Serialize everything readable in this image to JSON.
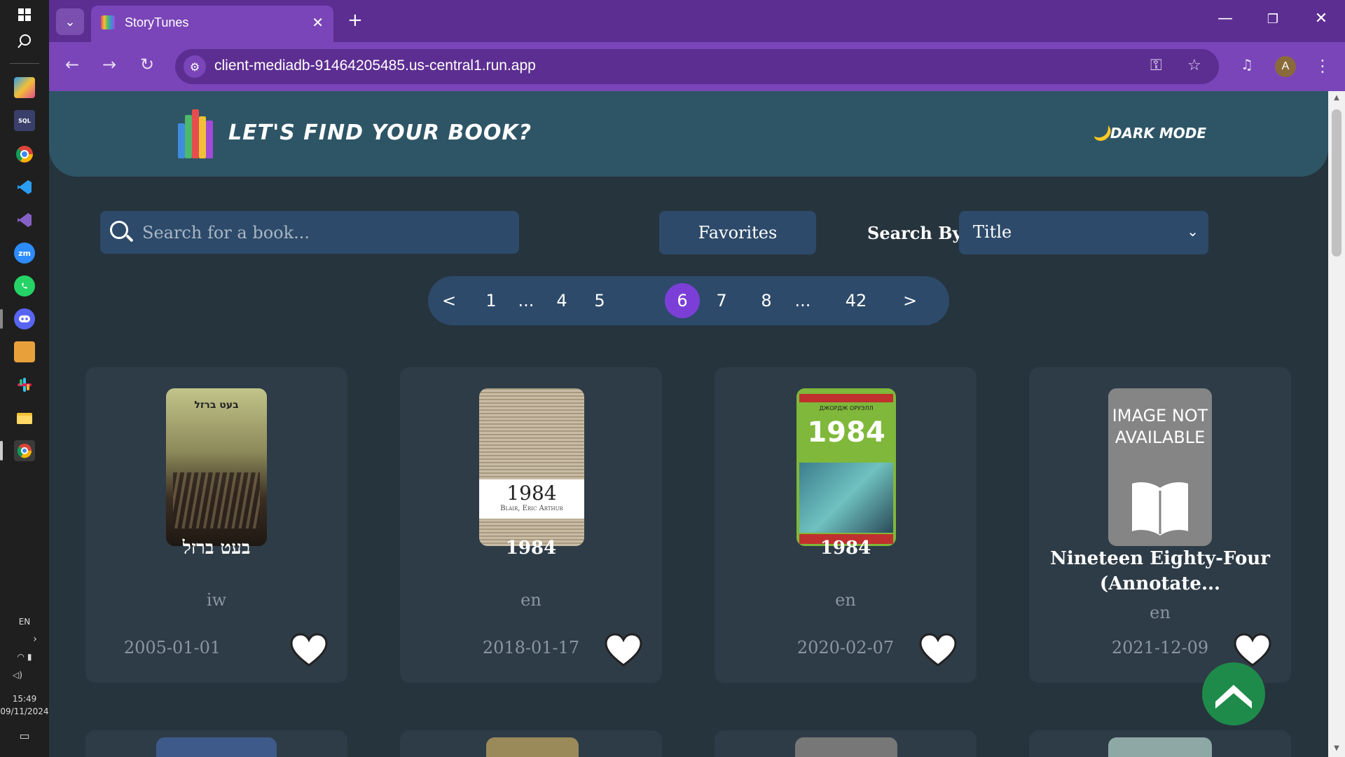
{
  "browser": {
    "tab_title": "StoryTunes",
    "url": "client-mediadb-91464205485.us-central1.run.app",
    "profile_initial": "A"
  },
  "taskbar": {
    "language": "EN",
    "time": "15:49",
    "date": "09/11/2024"
  },
  "header": {
    "title": "LET'S FIND YOUR BOOK?",
    "dark_mode_label": "DARK MODE",
    "dark_mode_icon": "🌙"
  },
  "search": {
    "placeholder": "Search for a book...",
    "favorites_label": "Favorites",
    "search_by_label": "Search By:",
    "search_by_value": "Title"
  },
  "pagination": {
    "prev": "<",
    "next": ">",
    "ellipsis": "...",
    "pages": [
      "1",
      "4",
      "5",
      "6",
      "7",
      "8",
      "42"
    ],
    "current": "6"
  },
  "books": [
    {
      "title": "בעט ברזל",
      "language": "iw",
      "date": "2005-01-01",
      "cover_text": "בעט ברזל"
    },
    {
      "title": "1984",
      "language": "en",
      "date": "2018-01-17",
      "cover_title": "1984",
      "cover_author": "Blair, Eric Arthur"
    },
    {
      "title": "1984",
      "language": "en",
      "date": "2020-02-07",
      "cover_title": "1984",
      "cover_author": "ДЖОРДЖ ОРУЭЛЛ"
    },
    {
      "title": "Nineteen Eighty-Four (Annotate...",
      "language": "en",
      "date": "2021-12-09",
      "cover_text": "IMAGE NOT AVAILABLE"
    }
  ],
  "colors": {
    "accent": "#7b3fd8",
    "header_bg": "#2e5566",
    "page_bg": "#26343d",
    "card_bg": "#2e3c47",
    "control_bg": "#2d4a6a",
    "scroll_top": "#1e8b4a"
  },
  "icons": {
    "heart": "heart-icon",
    "search": "search-icon",
    "scroll_top": "chevron-up-icon"
  }
}
